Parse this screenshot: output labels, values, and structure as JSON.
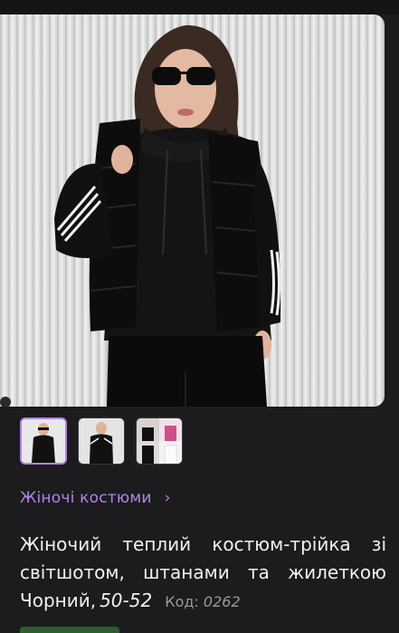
{
  "product": {
    "category": "Жіночі костюми",
    "title": "Жіночий теплий костюм-трійка зі світшотом, штанами та жилеткою Чорний,",
    "size": "50-52",
    "code_label": "Код:",
    "code_value": "0262"
  },
  "gallery": {
    "selected_index": 0,
    "thumb_count": 3
  },
  "colors": {
    "background": "#1c1c1e",
    "accent": "#b583e6",
    "text": "#f2f2f2",
    "muted": "#9a9a9e"
  },
  "icons": {
    "breadcrumb": "chevron-right-icon"
  }
}
